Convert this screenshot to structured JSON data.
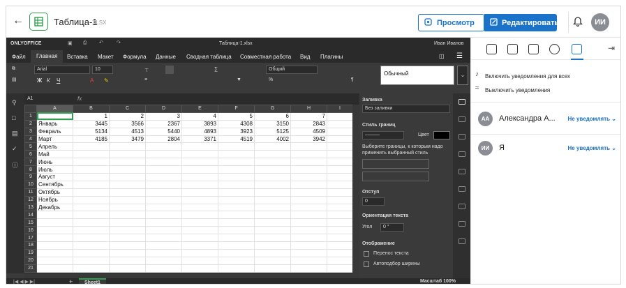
{
  "header": {
    "file_name": "Таблица-1",
    "file_ext": "XLSX",
    "view_label": "Просмотр",
    "edit_label": "Редактировать",
    "avatar_initials": "ИИ"
  },
  "editor": {
    "brand": "ONLYOFFICE",
    "doc_title": "Таблица-1.xlsx",
    "user_name": "Иван Иванов",
    "menu": [
      "Файл",
      "Главная",
      "Вставка",
      "Макет",
      "Формула",
      "Данные",
      "Сводная таблица",
      "Совместная работа",
      "Вид",
      "Плагины"
    ],
    "font_name": "Arial",
    "font_size": "10",
    "number_format": "Общий",
    "style_preview": "Обычный",
    "cell_ref": "A1",
    "fx": "fx",
    "sheet_tab": "Sheet1",
    "zoom": "Масштаб 100%"
  },
  "sheet": {
    "columns": [
      "A",
      "B",
      "C",
      "D",
      "E",
      "F",
      "G",
      "H",
      "I"
    ],
    "rows": [
      [
        "",
        "1",
        "2",
        "3",
        "4",
        "5",
        "6",
        "7",
        ""
      ],
      [
        "Январь",
        "3445",
        "3566",
        "2367",
        "3893",
        "4308",
        "3150",
        "2843",
        ""
      ],
      [
        "Февраль",
        "5134",
        "4513",
        "5440",
        "4893",
        "3923",
        "5125",
        "4509",
        ""
      ],
      [
        "Март",
        "4185",
        "3479",
        "2804",
        "3371",
        "4519",
        "4002",
        "3942",
        ""
      ],
      [
        "Апрель",
        "",
        "",
        "",
        "",
        "",
        "",
        "",
        ""
      ],
      [
        "Май",
        "",
        "",
        "",
        "",
        "",
        "",
        "",
        ""
      ],
      [
        "Июнь",
        "",
        "",
        "",
        "",
        "",
        "",
        "",
        ""
      ],
      [
        "Июль",
        "",
        "",
        "",
        "",
        "",
        "",
        "",
        ""
      ],
      [
        "Август",
        "",
        "",
        "",
        "",
        "",
        "",
        "",
        ""
      ],
      [
        "Сентябрь",
        "",
        "",
        "",
        "",
        "",
        "",
        "",
        ""
      ],
      [
        "Октябрь",
        "",
        "",
        "",
        "",
        "",
        "",
        "",
        ""
      ],
      [
        "Ноябрь",
        "",
        "",
        "",
        "",
        "",
        "",
        "",
        ""
      ],
      [
        "Декабрь",
        "",
        "",
        "",
        "",
        "",
        "",
        "",
        ""
      ],
      [
        "",
        "",
        "",
        "",
        "",
        "",
        "",
        "",
        ""
      ],
      [
        "",
        "",
        "",
        "",
        "",
        "",
        "",
        "",
        ""
      ],
      [
        "",
        "",
        "",
        "",
        "",
        "",
        "",
        "",
        ""
      ],
      [
        "",
        "",
        "",
        "",
        "",
        "",
        "",
        "",
        ""
      ],
      [
        "",
        "",
        "",
        "",
        "",
        "",
        "",
        "",
        ""
      ],
      [
        "",
        "",
        "",
        "",
        "",
        "",
        "",
        "",
        ""
      ],
      [
        "",
        "",
        "",
        "",
        "",
        "",
        "",
        "",
        ""
      ],
      [
        "",
        "",
        "",
        "",
        "",
        "",
        "",
        "",
        ""
      ]
    ]
  },
  "cell_panel": {
    "fill_label": "Заливка",
    "fill_value": "Без заливки",
    "border_style_label": "Стиль границ",
    "color_label": "Цвет",
    "border_hint": "Выберите границы, к которым надо применить выбранный стиль",
    "indent_label": "Отступ",
    "indent_value": "0",
    "orientation_label": "Ориентация текста",
    "angle_label": "Угол",
    "angle_value": "0 °",
    "display_label": "Отображение",
    "wrap_label": "Перенос текста",
    "autofit_label": "Автоподбор ширины"
  },
  "comments_panel": {
    "notify_all": "Включить уведомления для всех",
    "disable_notify": "Выключить уведомления",
    "users": [
      {
        "initials": "АА",
        "name": "Александра А...",
        "action": "Не уведомлять"
      },
      {
        "initials": "ИИ",
        "name": "Я",
        "action": "Не уведомлять"
      }
    ]
  }
}
